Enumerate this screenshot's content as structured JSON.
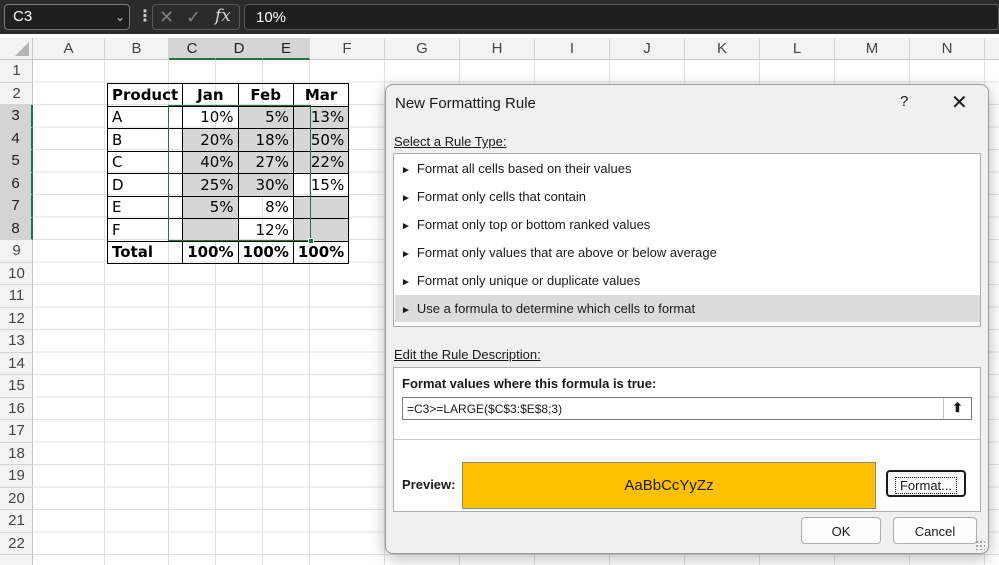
{
  "formula_bar": {
    "name_box": "C3",
    "content": "10%",
    "icons": {
      "more": "vertical-dots-icon",
      "cancel": "x-icon",
      "enter": "check-icon",
      "function": "fx-icon"
    },
    "fx_label": "fx"
  },
  "grid": {
    "columns": [
      "A",
      "B",
      "C",
      "D",
      "E",
      "F",
      "G",
      "H",
      "I",
      "J",
      "K",
      "L",
      "M",
      "N"
    ],
    "rows": [
      "1",
      "2",
      "3",
      "4",
      "5",
      "6",
      "7",
      "8",
      "9",
      "10",
      "11",
      "12",
      "13",
      "14",
      "15",
      "16",
      "17",
      "18",
      "19",
      "20",
      "21",
      "22"
    ],
    "selected_columns": [
      "C",
      "D",
      "E"
    ],
    "selected_rows": [
      "3",
      "4",
      "5",
      "6",
      "7",
      "8"
    ]
  },
  "table": {
    "headers": [
      "Product",
      "Jan",
      "Feb",
      "Mar"
    ],
    "rows": [
      {
        "product": "A",
        "jan": "10%",
        "feb": "5%",
        "mar": "13%"
      },
      {
        "product": "B",
        "jan": "20%",
        "feb": "18%",
        "mar": "50%"
      },
      {
        "product": "C",
        "jan": "40%",
        "feb": "27%",
        "mar": "22%"
      },
      {
        "product": "D",
        "jan": "25%",
        "feb": "30%",
        "mar": "15%"
      },
      {
        "product": "E",
        "jan": "5%",
        "feb": "8%",
        "mar": ""
      },
      {
        "product": "F",
        "jan": "",
        "feb": "12%",
        "mar": ""
      }
    ],
    "total": {
      "label": "Total",
      "jan": "100%",
      "feb": "100%",
      "mar": "100%"
    },
    "highlight_color": "#d6d6d6"
  },
  "dialog": {
    "title": "New Formatting Rule",
    "help": "?",
    "close": "✕",
    "select_rule_type_label": "Select a Rule Type:",
    "rule_types": [
      "Format all cells based on their values",
      "Format only cells that contain",
      "Format only top or bottom ranked values",
      "Format only values that are above or below average",
      "Format only unique or duplicate values",
      "Use a formula to determine which cells to format"
    ],
    "selected_rule": "Use a formula to determine which cells to format",
    "edit_description_label": "Edit the Rule Description:",
    "formula_label": "Format values where this formula is true:",
    "formula_value": "=C3>=LARGE($C$3:$E$8;3)",
    "preview_label": "Preview:",
    "preview_text": "AaBbCcYyZz",
    "preview_fill": "#ffc000",
    "format_button": "Format...",
    "ok_button": "OK",
    "cancel_button": "Cancel"
  }
}
